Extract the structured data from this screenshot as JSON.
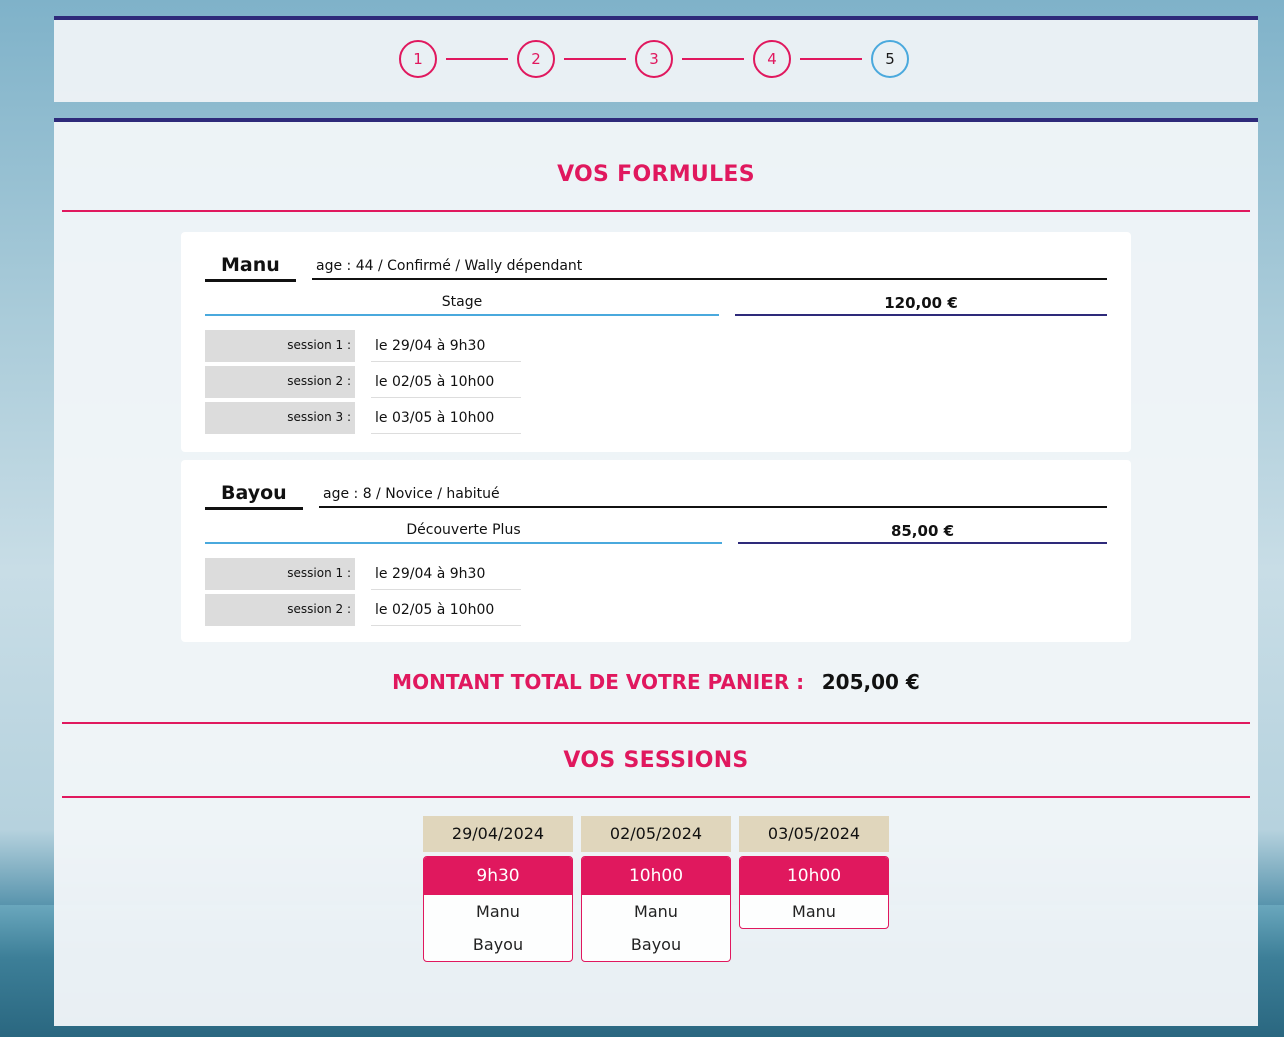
{
  "stepper": {
    "steps": [
      "1",
      "2",
      "3",
      "4",
      "5"
    ],
    "active_step": "5"
  },
  "formules": {
    "title": "VOS FORMULES",
    "participants": [
      {
        "name": "Manu",
        "info": "age : 44 / Confirmé / Wally dépendant",
        "formula": "Stage",
        "price": "120,00 €",
        "sessions": [
          {
            "label": "session 1 :",
            "value": "le 29/04 à 9h30"
          },
          {
            "label": "session 2 :",
            "value": "le 02/05 à 10h00"
          },
          {
            "label": "session 3 :",
            "value": "le 03/05 à 10h00"
          }
        ]
      },
      {
        "name": "Bayou",
        "info": "age : 8 / Novice / habitué",
        "formula": "Découverte Plus",
        "price": "85,00 €",
        "sessions": [
          {
            "label": "session 1 :",
            "value": "le 29/04 à 9h30"
          },
          {
            "label": "session 2 :",
            "value": "le 02/05 à 10h00"
          }
        ]
      }
    ]
  },
  "total": {
    "label": "MONTANT TOTAL DE VOTRE PANIER :",
    "value": "205,00 €"
  },
  "sessions": {
    "title": "VOS SESSIONS",
    "columns": [
      {
        "date": "29/04/2024",
        "time": "9h30",
        "names": [
          "Manu",
          "Bayou"
        ]
      },
      {
        "date": "02/05/2024",
        "time": "10h00",
        "names": [
          "Manu",
          "Bayou"
        ]
      },
      {
        "date": "03/05/2024",
        "time": "10h00",
        "names": [
          "Manu"
        ]
      }
    ]
  },
  "colors": {
    "accent": "#e0185e",
    "navy": "#2e2a7a",
    "blue": "#4aa9dd",
    "date_bg": "#e0d6bc"
  }
}
